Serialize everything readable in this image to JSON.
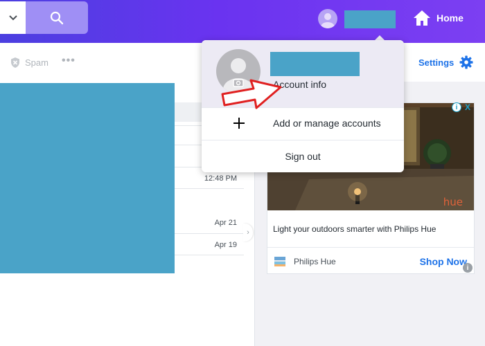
{
  "header": {
    "home_label": "Home"
  },
  "toolbar": {
    "spam_label": "Spam",
    "more_label": "•••",
    "settings_label": "Settings"
  },
  "messages": {
    "dates": [
      "12:48 PM",
      "Apr 21",
      "Apr 19"
    ]
  },
  "ad": {
    "brand_mark": "hue",
    "headline": "Light your outdoors smarter with Philips Hue",
    "brand": "Philips Hue",
    "cta": "Shop Now",
    "info_icon": "i",
    "close_icon": "X"
  },
  "account_menu": {
    "account_info": "Account info",
    "add_manage": "Add or manage accounts",
    "sign_out": "Sign out"
  },
  "colors": {
    "header_start": "#4b3fe0",
    "header_end": "#7c3ff2",
    "accent_blue": "#1d72e8",
    "redaction": "#4aa3c8",
    "annotation_red": "#e02020"
  }
}
